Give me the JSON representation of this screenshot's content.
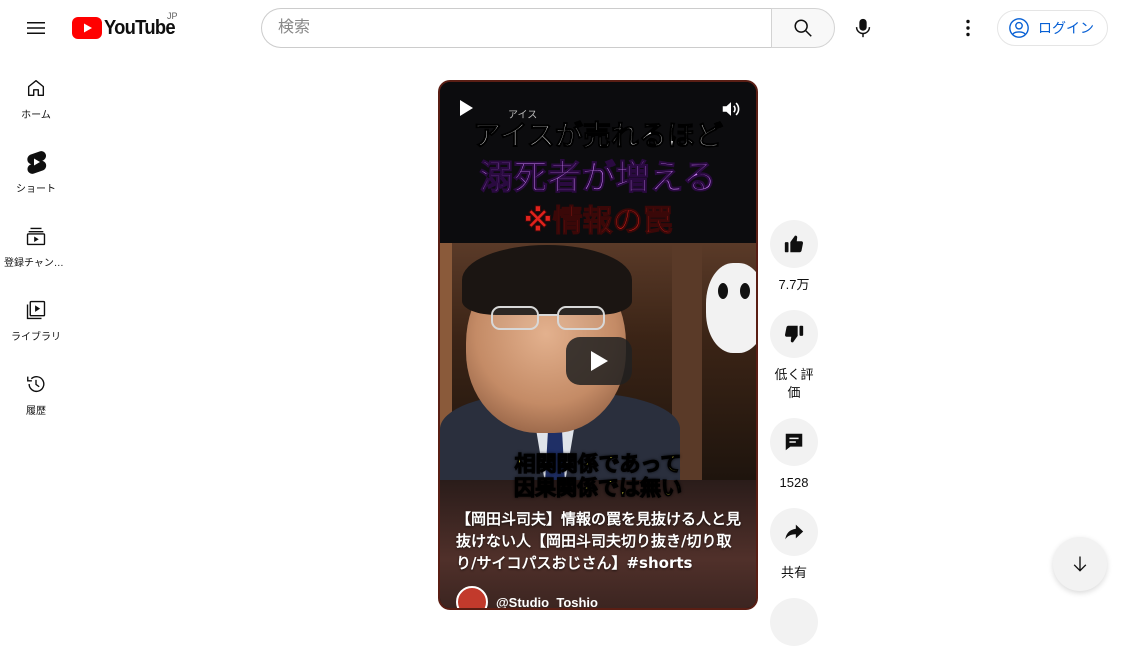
{
  "header": {
    "logo_text": "YouTube",
    "region": "JP",
    "search_placeholder": "検索",
    "login_label": "ログイン"
  },
  "sidebar": {
    "items": [
      {
        "label": "ホーム",
        "icon": "home-icon"
      },
      {
        "label": "ショート",
        "icon": "shorts-icon"
      },
      {
        "label": "登録チャンネル",
        "icon": "subscriptions-icon"
      },
      {
        "label": "ライブラリ",
        "icon": "library-icon"
      },
      {
        "label": "履歴",
        "icon": "history-icon"
      }
    ]
  },
  "video": {
    "overlay_small": "アイス",
    "headline_1": "アイスが売れるほど",
    "headline_2": "溺死者が増える",
    "headline_3": "※情報の罠",
    "caption_1": "相関関係であって",
    "caption_2": "因果関係では無い",
    "title": "【岡田斗司夫】情報の罠を見抜ける人と見抜けない人【岡田斗司夫切り抜き/切り取り/サイコパスおじさん】#shorts",
    "channel_name": "@Studio_Toshio"
  },
  "actions": {
    "like_count": "7.7万",
    "dislike_label": "低く評価",
    "comment_count": "1528",
    "share_label": "共有"
  },
  "colors": {
    "brand_red": "#ff0000",
    "link_blue": "#065fd4",
    "headline_purple": "#c77df2",
    "headline_red": "#e1221c",
    "caption_yellow": "#f6f04a"
  }
}
